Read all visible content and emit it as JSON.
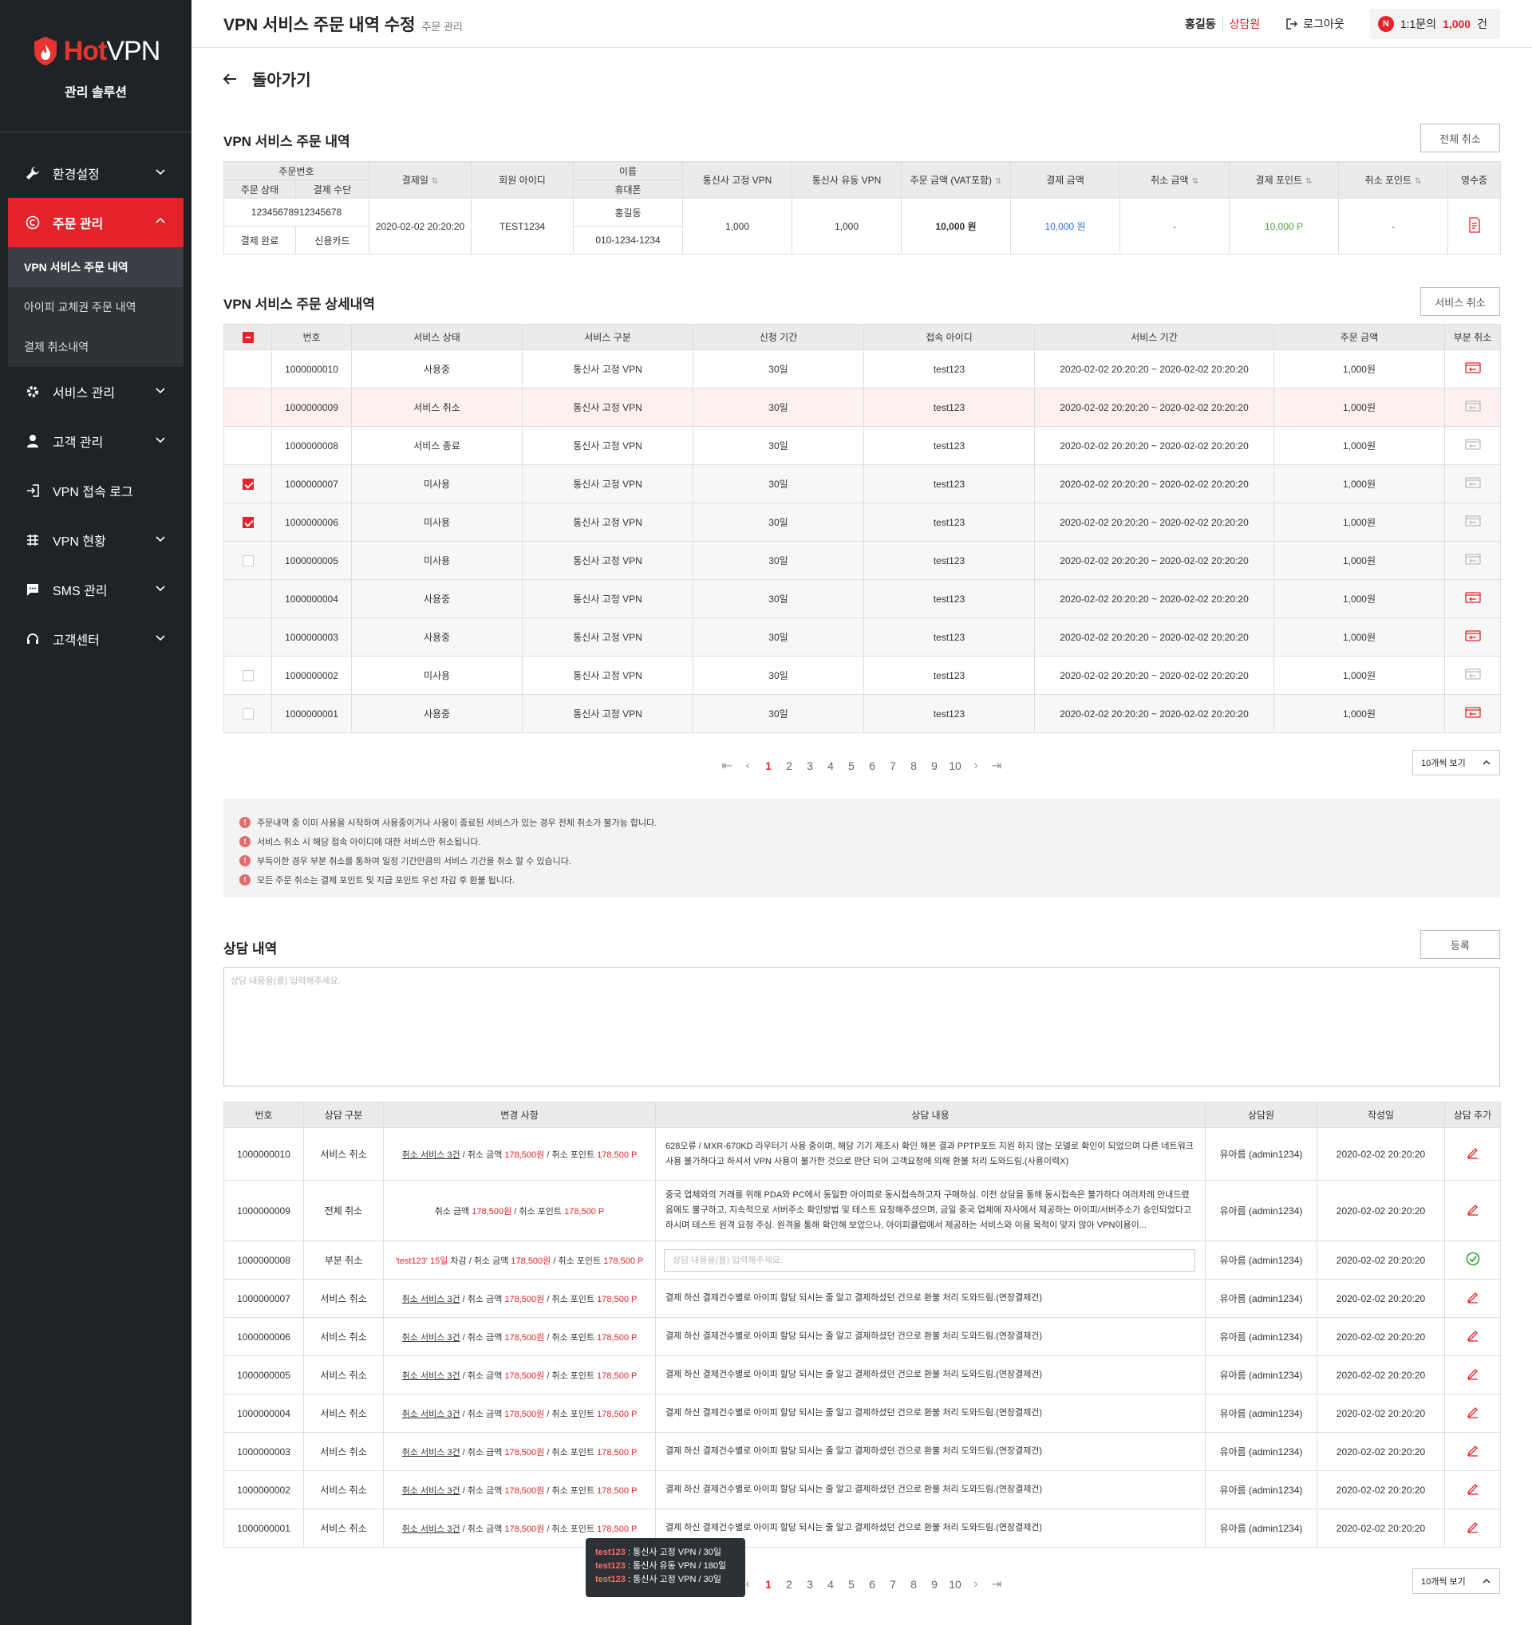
{
  "sidebar": {
    "logo_hot": "Hot",
    "logo_vpn": "VPN",
    "logo_sub": "관리 솔루션",
    "items": [
      {
        "label": "환경설정"
      },
      {
        "label": "주문 관리"
      },
      {
        "label": "서비스 관리"
      },
      {
        "label": "고객 관리"
      },
      {
        "label": "VPN 접속 로그"
      },
      {
        "label": "VPN 현황"
      },
      {
        "label": "SMS 관리"
      },
      {
        "label": "고객센터"
      }
    ],
    "sub_items": [
      {
        "label": "VPN 서비스 주문 내역"
      },
      {
        "label": "아이피 교체권 주문 내역"
      },
      {
        "label": "결제 취소내역"
      }
    ]
  },
  "header": {
    "title": "VPN 서비스 주문 내역 수정",
    "breadcrumb": "주문 관리",
    "user_name": "홍길동",
    "user_role": "상담원",
    "logout": "로그아웃",
    "badge": "N",
    "inquiry_label": "1:1문의",
    "inquiry_count": "1,000",
    "inquiry_unit": "건"
  },
  "back_label": "돌아가기",
  "order": {
    "title": "VPN 서비스 주문 내역",
    "cancel_all": "전체 취소",
    "headers": {
      "order_no": "주문번호",
      "order_status": "주문 상태",
      "pay_method": "결제 수단",
      "pay_date": "결제일",
      "member_id": "회원 아이디",
      "name": "이름",
      "phone": "휴대폰",
      "fixed_vpn": "통신사 고정 VPN",
      "dynamic_vpn": "통신사 유동 VPN",
      "order_amount": "주문 금액 (VAT포함)",
      "pay_amount": "결제 금액",
      "cancel_amount": "취소 금액",
      "pay_point": "결제 포인트",
      "cancel_point": "취소 포인트",
      "receipt": "영수증"
    },
    "row": {
      "order_no": "12345678912345678",
      "order_status": "결제 완료",
      "pay_method": "신용카드",
      "pay_date": "2020-02-02 20:20:20",
      "member_id": "TEST1234",
      "name": "홍길동",
      "phone": "010-1234-1234",
      "fixed_vpn": "1,000",
      "dynamic_vpn": "1,000",
      "order_amount": "10,000 원",
      "pay_amount": "10,000 원",
      "cancel_amount": "-",
      "pay_point": "10,000 P",
      "cancel_point": "-"
    }
  },
  "detail": {
    "title": "VPN 서비스 주문 상세내역",
    "cancel_service": "서비스 취소",
    "headers": [
      "번호",
      "서비스 상태",
      "서비스 구분",
      "신청 기간",
      "접속 아이디",
      "서비스 기간",
      "주문 금액",
      "부분 취소"
    ],
    "rows": [
      {
        "no": "1000000010",
        "status": "사용중",
        "type": "통신사 고정 VPN",
        "period": "30일",
        "id": "test123",
        "range": "2020-02-02 20:20:20 ~ 2020-02-02 20:20:20",
        "amount": "1,000원"
      },
      {
        "no": "1000000009",
        "status": "서비스 취소",
        "type": "통신사 고정 VPN",
        "period": "30일",
        "id": "test123",
        "range": "2020-02-02 20:20:20 ~ 2020-02-02 20:20:20",
        "amount": "1,000원"
      },
      {
        "no": "1000000008",
        "status": "서비스 종료",
        "type": "통신사 고정 VPN",
        "period": "30일",
        "id": "test123",
        "range": "2020-02-02 20:20:20 ~ 2020-02-02 20:20:20",
        "amount": "1,000원"
      },
      {
        "no": "1000000007",
        "status": "미사용",
        "type": "통신사 고정 VPN",
        "period": "30일",
        "id": "test123",
        "range": "2020-02-02 20:20:20 ~ 2020-02-02 20:20:20",
        "amount": "1,000원"
      },
      {
        "no": "1000000006",
        "status": "미사용",
        "type": "통신사 고정 VPN",
        "period": "30일",
        "id": "test123",
        "range": "2020-02-02 20:20:20 ~ 2020-02-02 20:20:20",
        "amount": "1,000원"
      },
      {
        "no": "1000000005",
        "status": "미사용",
        "type": "통신사 고정 VPN",
        "period": "30일",
        "id": "test123",
        "range": "2020-02-02 20:20:20 ~ 2020-02-02 20:20:20",
        "amount": "1,000원"
      },
      {
        "no": "1000000004",
        "status": "사용중",
        "type": "통신사 고정 VPN",
        "period": "30일",
        "id": "test123",
        "range": "2020-02-02 20:20:20 ~ 2020-02-02 20:20:20",
        "amount": "1,000원"
      },
      {
        "no": "1000000003",
        "status": "사용중",
        "type": "통신사 고정 VPN",
        "period": "30일",
        "id": "test123",
        "range": "2020-02-02 20:20:20 ~ 2020-02-02 20:20:20",
        "amount": "1,000원"
      },
      {
        "no": "1000000002",
        "status": "미사용",
        "type": "통신사 고정 VPN",
        "period": "30일",
        "id": "test123",
        "range": "2020-02-02 20:20:20 ~ 2020-02-02 20:20:20",
        "amount": "1,000원"
      },
      {
        "no": "1000000001",
        "status": "사용중",
        "type": "통신사 고정 VPN",
        "period": "30일",
        "id": "test123",
        "range": "2020-02-02 20:20:20 ~ 2020-02-02 20:20:20",
        "amount": "1,000원"
      }
    ]
  },
  "pager": {
    "pages": [
      "1",
      "2",
      "3",
      "4",
      "5",
      "6",
      "7",
      "8",
      "9",
      "10"
    ],
    "per_page": "10개씩 보기"
  },
  "notices": [
    "주문내역 중 이미 사용을 시작하여 사용중이거나 사용이 종료된 서비스가 있는 경우 전체 취소가 불가능 합니다.",
    "서비스 취소 시 해당 접속 아이디에 대한 서비스만 취소됩니다.",
    "부득이한 경우 부분 취소를 통하여 일정 기간만큼의 서비스 기간을 취소 할 수 있습니다.",
    "모든 주문 취소는 결제 포인트 및 지급 포인트 우선 차감 후 환불 됩니다."
  ],
  "consult": {
    "title": "상담 내역",
    "register": "등록",
    "placeholder": "상담 내용을(를) 입력해주세요.",
    "headers": [
      "번호",
      "상담 구분",
      "변경 사항",
      "상담 내용",
      "상담원",
      "작성일",
      "상담 추가"
    ],
    "rows": [
      {
        "no": "1000000010",
        "type": "서비스 취소",
        "change": "svc",
        "content": "628오류 / MXR-670KD 라우터기 사용 중이며, 해당 기기 제조사 확인 해본 결과 PPTP포트 지원 하지 않는 모델로 확인이 되었으며 다른 네트워크 사용 불가하다고 하셔서 VPN 사용이 불가한 것으로 판단 되어 고객요청에 의해 환불 처리 도와드림.(사용이력X)",
        "agent": "유아름 (admin1234)",
        "date": "2020-02-02 20:20:20"
      },
      {
        "no": "1000000009",
        "type": "전체 취소",
        "change": "all",
        "content": "중국 업체와의 거래를 위해 PDA와 PC에서 동일한 아이피로 동시접속하고자 구매하심. 이전 상담을 통해 동시접속은 불가하다 여러차례 안내드렸음에도 불구하고, 지속적으로 서버주소 확인방법 및 테스트 요청해주셨으며, 금일 중국 업체에 자사에서 제공하는 아이피/서버주소가 승인되었다고 하시며 테스트 원격 요청 주심. 원격을 통해 확인해 보았으나, 아이피클럽에서 제공하는 서비스와 이용 목적이 맞지 않아 VPN이용이...",
        "agent": "유아름 (admin1234)",
        "date": "2020-02-02 20:20:20"
      },
      {
        "no": "1000000008",
        "type": "부분 취소",
        "change": "part",
        "content": "",
        "agent": "유아름 (admin1234)",
        "date": "2020-02-02 20:20:20"
      },
      {
        "no": "1000000007",
        "type": "서비스 취소",
        "change": "svc",
        "content": "결제 하신 결제건수별로 아이피 할당 되시는 줄 알고 결제하셨던 건으로 환불 처리 도와드림.(연장결제건)",
        "agent": "유아름 (admin1234)",
        "date": "2020-02-02 20:20:20"
      },
      {
        "no": "1000000006",
        "type": "서비스 취소",
        "change": "svc",
        "content": "결제 하신 결제건수별로 아이피 할당 되시는 줄 알고 결제하셨던 건으로 환불 처리 도와드림.(연장결제건)",
        "agent": "유아름 (admin1234)",
        "date": "2020-02-02 20:20:20"
      },
      {
        "no": "1000000005",
        "type": "서비스 취소",
        "change": "svc",
        "content": "결제 하신 결제건수별로 아이피 할당 되시는 줄 알고 결제하셨던 건으로 환불 처리 도와드림.(연장결제건)",
        "agent": "유아름 (admin1234)",
        "date": "2020-02-02 20:20:20"
      },
      {
        "no": "1000000004",
        "type": "서비스 취소",
        "change": "svc",
        "content": "결제 하신 결제건수별로 아이피 할당 되시는 줄 알고 결제하셨던 건으로 환불 처리 도와드림.(연장결제건)",
        "agent": "유아름 (admin1234)",
        "date": "2020-02-02 20:20:20"
      },
      {
        "no": "1000000003",
        "type": "서비스 취소",
        "change": "svc",
        "content": "결제 하신 결제건수별로 아이피 할당 되시는 줄 알고 결제하셨던 건으로 환불 처리 도와드림.(연장결제건)",
        "agent": "유아름 (admin1234)",
        "date": "2020-02-02 20:20:20"
      },
      {
        "no": "1000000002",
        "type": "서비스 취소",
        "change": "svc",
        "content": "결제 하신 결제건수별로 아이피 할당 되시는 줄 알고 결제하셨던 건으로 환불 처리 도와드림.(연장결제건)",
        "agent": "유아름 (admin1234)",
        "date": "2020-02-02 20:20:20"
      },
      {
        "no": "1000000001",
        "type": "서비스 취소",
        "change": "svc",
        "content": "결제 하신 결제건수별로 아이피 할당 되시는 줄 알고 결제하셨던 건으로 환불 처리 도와드림.(연장결제건)",
        "agent": "유아름 (admin1234)",
        "date": "2020-02-02 20:20:20"
      }
    ],
    "change_text": {
      "svc_link": "취소 서비스 3건",
      "amount_label": " / 취소 금액 ",
      "amount": "178,500원",
      "point_label": " / 취소 포인트 ",
      "point": "178,500 P",
      "all_amount_label": "취소 금액 ",
      "part_prefix": "'test123' 15일",
      "part_suffix": " 차감"
    },
    "tooltip": [
      {
        "id": "test123",
        "text": " : 통신사 고정 VPN / 30일"
      },
      {
        "id": "test123",
        "text": " : 통신사 유동 VPN / 180일"
      },
      {
        "id": "test123",
        "text": " : 통신사 고정 VPN / 30일"
      }
    ]
  },
  "colors": {
    "accent": "#e4232a",
    "sidebar_bg": "#1f2327",
    "blue": "#2e6fd6",
    "green": "#4aa32f"
  }
}
